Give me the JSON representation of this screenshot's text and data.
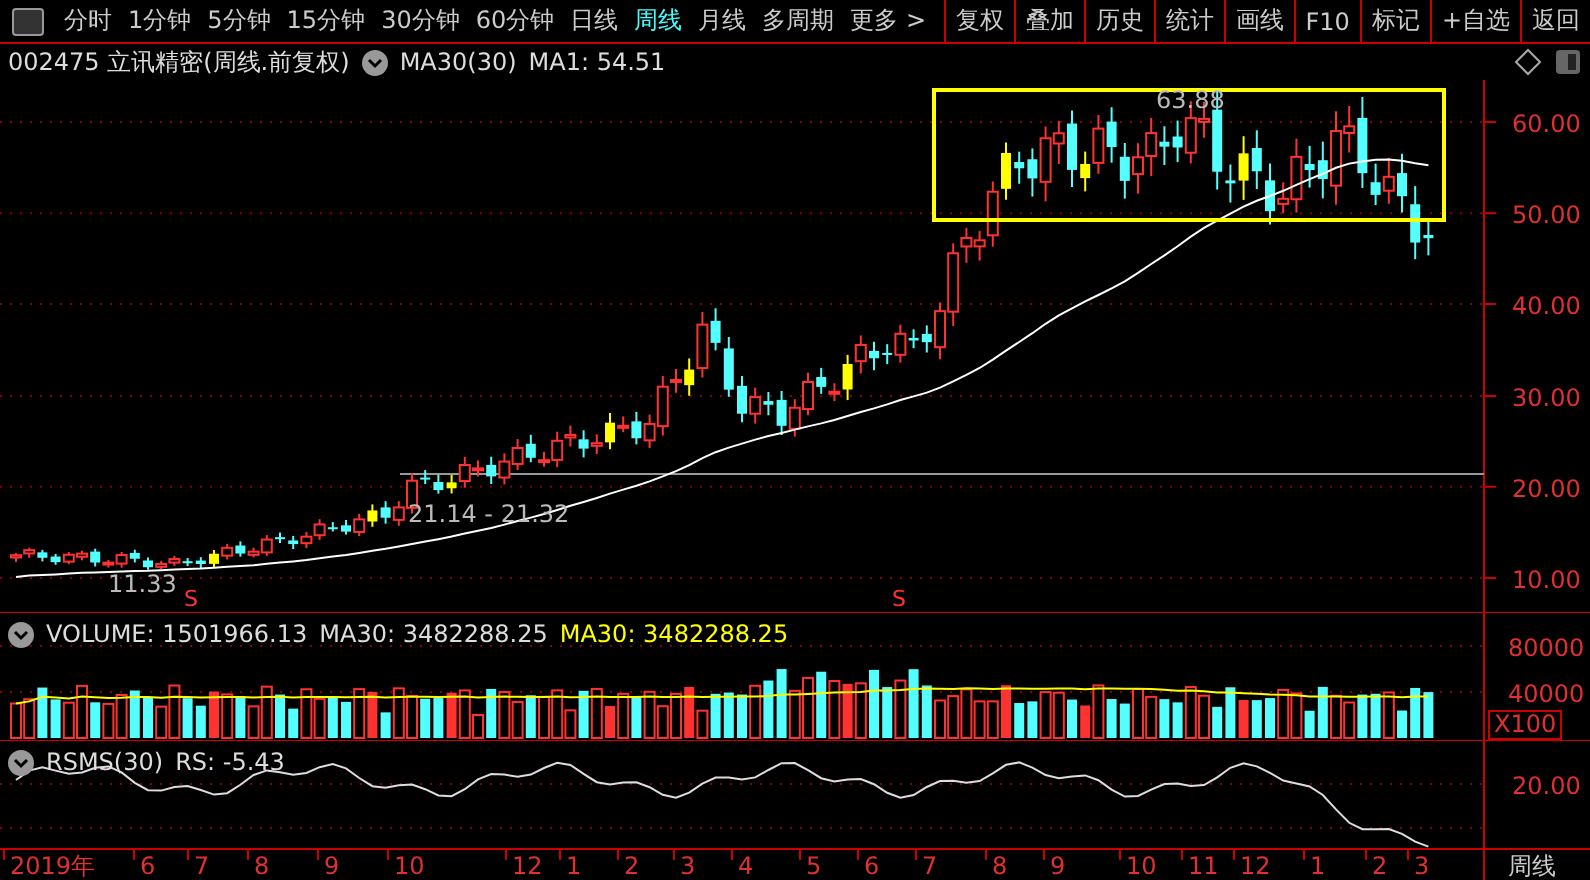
{
  "toolbar": {
    "tabs": [
      {
        "label": "分时",
        "selected": false
      },
      {
        "label": "1分钟",
        "selected": false
      },
      {
        "label": "5分钟",
        "selected": false
      },
      {
        "label": "15分钟",
        "selected": false
      },
      {
        "label": "30分钟",
        "selected": false
      },
      {
        "label": "60分钟",
        "selected": false
      },
      {
        "label": "日线",
        "selected": false
      },
      {
        "label": "周线",
        "selected": true
      },
      {
        "label": "月线",
        "selected": false
      },
      {
        "label": "多周期",
        "selected": false
      },
      {
        "label": "更多 >",
        "selected": false
      }
    ],
    "actions": [
      "复权",
      "叠加",
      "历史",
      "统计",
      "画线",
      "F10",
      "标记",
      "+自选",
      "返回"
    ]
  },
  "price_panel": {
    "title": "002475 立讯精密(周线.前复权)",
    "indicator": "MA30(30)",
    "reading": "MA1: 54.51",
    "y_labels": [
      "60.00",
      "50.00",
      "40.00",
      "30.00",
      "20.00",
      "10.00"
    ],
    "annotations": [
      "63.88",
      "21.14 - 21.32",
      "11.33"
    ],
    "markers": [
      "S",
      "S"
    ]
  },
  "volume_panel": {
    "indicator": "VOLUME: 1501966.13",
    "ma_reading": "MA30: 3482288.25",
    "ma_reading_highlight": "MA30: 3482288.25",
    "y_labels": [
      "80000",
      "40000"
    ],
    "unit": "X100"
  },
  "rs_panel": {
    "indicator": "RSMS(30)",
    "reading": "RS: -5.43",
    "y_labels": [
      "20.00"
    ]
  },
  "x_axis": {
    "labels": [
      "2019年",
      "6",
      "7",
      "8",
      "9",
      "10",
      "12",
      "1",
      "2",
      "3",
      "4",
      "5",
      "6",
      "7",
      "8",
      "9",
      "10",
      "11",
      "12",
      "1",
      "2",
      "3"
    ],
    "period": "周线"
  }
}
